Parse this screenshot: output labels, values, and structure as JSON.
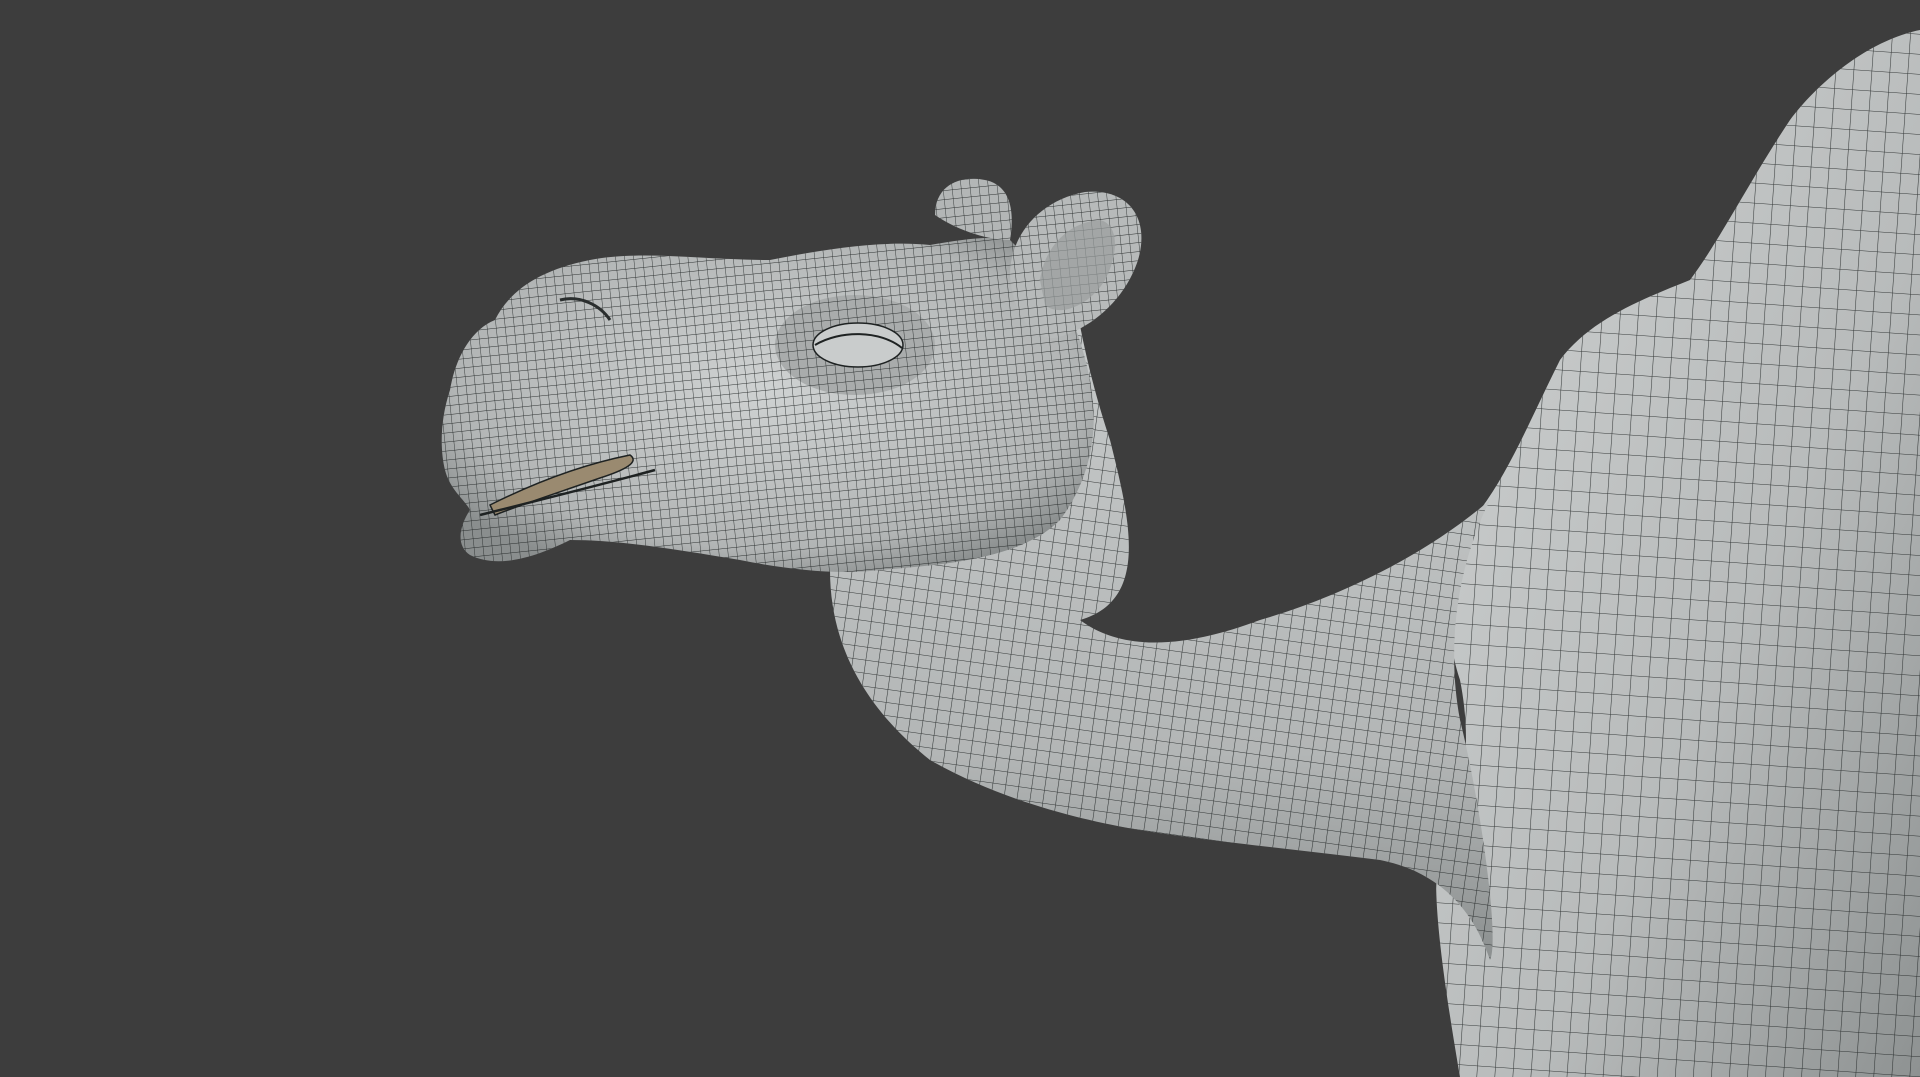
{
  "viewport": {
    "background_color": "#3d3d3d",
    "shading": "solid-wireframe",
    "subject": "camel-mesh"
  },
  "mesh": {
    "surface_color": "#b9bcbc",
    "shadow_color": "#7f8383",
    "highlight_color": "#d6d8d8",
    "wire_color": "#1e2222",
    "mouth_interior_color": "#9a8a70"
  }
}
